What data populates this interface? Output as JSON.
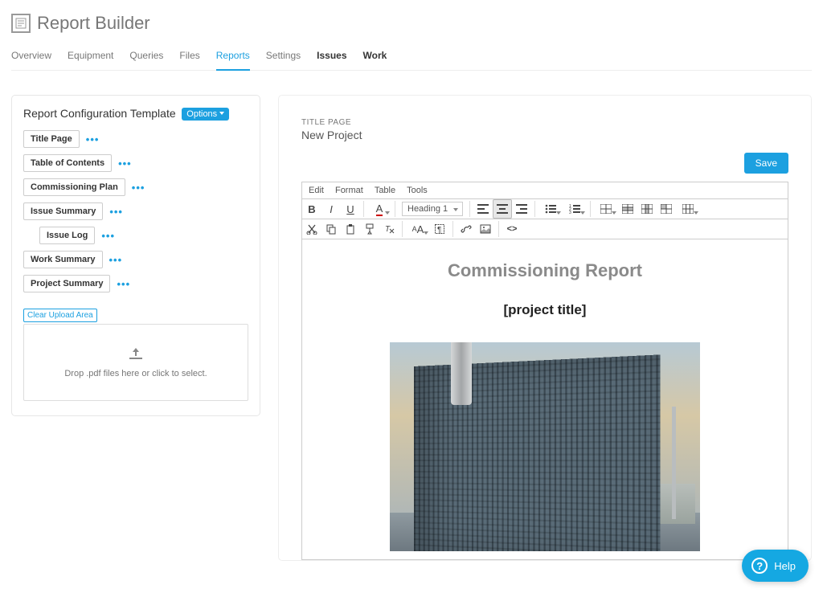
{
  "header": {
    "title": "Report Builder"
  },
  "nav": {
    "tabs": [
      {
        "label": "Overview",
        "active": false,
        "strong": false
      },
      {
        "label": "Equipment",
        "active": false,
        "strong": false
      },
      {
        "label": "Queries",
        "active": false,
        "strong": false
      },
      {
        "label": "Files",
        "active": false,
        "strong": false
      },
      {
        "label": "Reports",
        "active": true,
        "strong": false
      },
      {
        "label": "Settings",
        "active": false,
        "strong": false
      },
      {
        "label": "Issues",
        "active": false,
        "strong": true
      },
      {
        "label": "Work",
        "active": false,
        "strong": true
      }
    ]
  },
  "sidebar": {
    "title": "Report Configuration Template",
    "options_label": "Options",
    "sections": [
      {
        "label": "Title Page",
        "indent": false
      },
      {
        "label": "Table of Contents",
        "indent": false
      },
      {
        "label": "Commissioning Plan",
        "indent": false
      },
      {
        "label": "Issue Summary",
        "indent": false
      },
      {
        "label": "Issue Log",
        "indent": true
      },
      {
        "label": "Work Summary",
        "indent": false
      },
      {
        "label": "Project Summary",
        "indent": false
      }
    ],
    "clear_upload_label": "Clear Upload Area",
    "dropzone_text": "Drop .pdf files here or click to select."
  },
  "main": {
    "section_label": "TITLE PAGE",
    "project_name": "New Project",
    "save_label": "Save",
    "menubar": [
      "Edit",
      "Format",
      "Table",
      "Tools"
    ],
    "heading_select": "Heading 1",
    "document": {
      "title": "Commissioning Report",
      "subtitle": "[project title]"
    }
  },
  "help": {
    "label": "Help"
  }
}
